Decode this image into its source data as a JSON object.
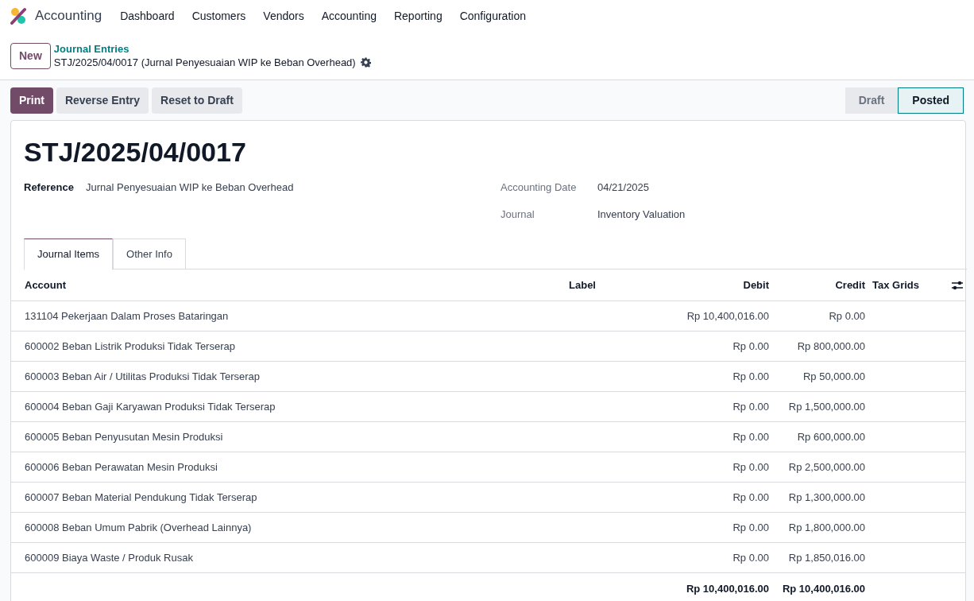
{
  "navbar": {
    "app": "Accounting",
    "menu": [
      "Dashboard",
      "Customers",
      "Vendors",
      "Accounting",
      "Reporting",
      "Configuration"
    ]
  },
  "control_panel": {
    "new_button": "New",
    "breadcrumb": "Journal Entries",
    "record": "STJ/2025/04/0017 (Jurnal Penyesuaian WIP ke Beban Overhead)"
  },
  "actions": [
    {
      "label": "Print",
      "kind": "primary"
    },
    {
      "label": "Reverse Entry",
      "kind": "secondary"
    },
    {
      "label": "Reset to Draft",
      "kind": "secondary"
    }
  ],
  "status": [
    {
      "label": "Draft",
      "selected": false
    },
    {
      "label": "Posted",
      "selected": true
    }
  ],
  "form": {
    "title": "STJ/2025/04/0017",
    "left_fields": [
      {
        "label": "Reference",
        "value": "Jurnal Penyesuaian WIP ke Beban Overhead"
      }
    ],
    "right_fields": [
      {
        "label": "Accounting Date",
        "value": "04/21/2025"
      },
      {
        "label": "Journal",
        "value": "Inventory Valuation"
      }
    ]
  },
  "tabs": [
    {
      "label": "Journal Items",
      "selected": true
    },
    {
      "label": "Other Info",
      "selected": false
    }
  ],
  "table": {
    "columns": [
      "Account",
      "Label",
      "Debit",
      "Credit",
      "Tax Grids"
    ],
    "rows": [
      {
        "account": "131104 Pekerjaan Dalam Proses Bataringan",
        "debit": "Rp 10,400,016.00",
        "credit": "Rp 0.00"
      },
      {
        "account": "600002 Beban Listrik Produksi Tidak Terserap",
        "debit": "Rp 0.00",
        "credit": "Rp 800,000.00"
      },
      {
        "account": "600003 Beban Air / Utilitas Produksi Tidak Terserap",
        "debit": "Rp 0.00",
        "credit": "Rp 50,000.00"
      },
      {
        "account": "600004 Beban Gaji Karyawan Produksi Tidak Terserap",
        "debit": "Rp 0.00",
        "credit": "Rp 1,500,000.00"
      },
      {
        "account": "600005 Beban Penyusutan Mesin Produksi",
        "debit": "Rp 0.00",
        "credit": "Rp 600,000.00"
      },
      {
        "account": "600006 Beban Perawatan Mesin Produksi",
        "debit": "Rp 0.00",
        "credit": "Rp 2,500,000.00"
      },
      {
        "account": "600007 Beban Material Pendukung Tidak Terserap",
        "debit": "Rp 0.00",
        "credit": "Rp 1,300,000.00"
      },
      {
        "account": "600008 Beban Umum Pabrik (Overhead Lainnya)",
        "debit": "Rp 0.00",
        "credit": "Rp 1,800,000.00"
      },
      {
        "account": "600009 Biaya Waste / Produk Rusak",
        "debit": "Rp 0.00",
        "credit": "Rp 1,850,016.00"
      }
    ],
    "totals": {
      "debit": "Rp 10,400,016.00",
      "credit": "Rp 10,400,016.00"
    }
  }
}
